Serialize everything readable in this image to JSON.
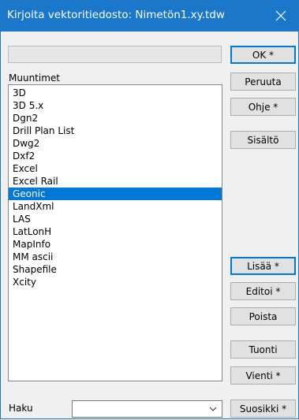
{
  "window": {
    "title": "Kirjoita vektoritiedosto: Nimetön1.xy.tdw"
  },
  "list": {
    "label": "Muuntimet",
    "items": [
      "3D",
      "3D 5.x",
      "Dgn2",
      "Drill Plan List",
      "Dwg2",
      "Dxf2",
      "Excel",
      "Excel Rail",
      "Geonic",
      "LandXml",
      "LAS",
      "LatLonH",
      "MapInfo",
      "MM ascii",
      "Shapefile",
      "Xcity"
    ],
    "selected": "Geonic"
  },
  "buttons": {
    "ok": "OK *",
    "cancel": "Peruuta",
    "help": "Ohje *",
    "contents": "Sisältö",
    "add": "Lisää *",
    "edit": "Editoi *",
    "delete": "Poista",
    "import": "Tuonti",
    "export": "Vienti *",
    "favorite": "Suosikki *"
  },
  "search": {
    "label": "Haku",
    "value": ""
  },
  "colors": {
    "accent": "#0078d7",
    "titlebar": "#1a77c9"
  }
}
